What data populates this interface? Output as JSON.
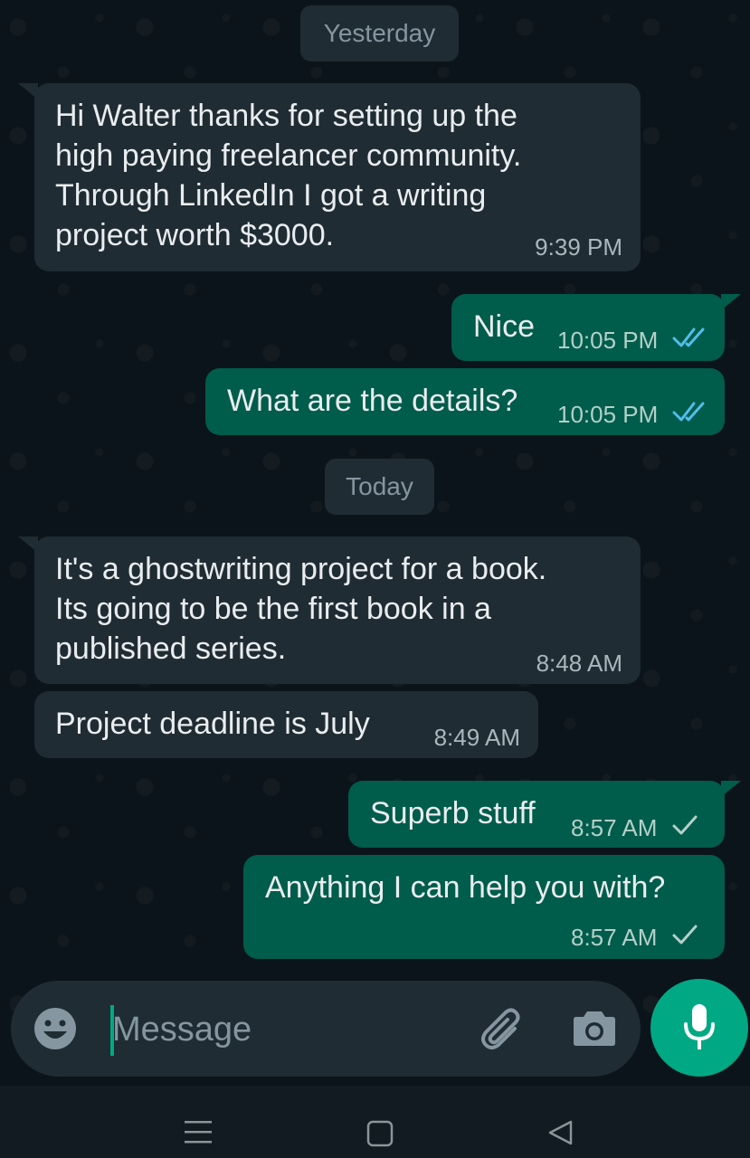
{
  "chat": {
    "dates": {
      "yesterday": "Yesterday",
      "today": "Today"
    },
    "messages": [
      {
        "direction": "in",
        "text": "Hi Walter thanks for setting up the\nhigh paying freelancer community.\nThrough LinkedIn I got a writing\nproject worth $3000.",
        "time": "9:39 PM"
      },
      {
        "direction": "out",
        "text": "Nice",
        "time": "10:05 PM",
        "status": "read"
      },
      {
        "direction": "out",
        "text": "What are the details?",
        "time": "10:05 PM",
        "status": "read"
      },
      {
        "direction": "in",
        "text": "It's a ghostwriting project for a book.\nIts going to be the first book in a\npublished series.",
        "time": "8:48 AM"
      },
      {
        "direction": "in",
        "text": "Project deadline is July",
        "time": "8:49 AM"
      },
      {
        "direction": "out",
        "text": "Superb stuff",
        "time": "8:57 AM",
        "status": "sent"
      },
      {
        "direction": "out",
        "text": "Anything I can help you with?",
        "time": "8:57 AM",
        "status": "sent"
      }
    ]
  },
  "composer": {
    "placeholder": "Message",
    "icons": [
      "emoji-icon",
      "attach-icon",
      "camera-icon",
      "mic-icon"
    ]
  },
  "navigation": {
    "icons": [
      "menu-icon",
      "home-icon",
      "back-icon"
    ]
  },
  "colors": {
    "incoming_bubble": "#202c33",
    "outgoing_bubble": "#005c4b",
    "accent": "#00a884",
    "read_tick": "#53bdeb"
  }
}
